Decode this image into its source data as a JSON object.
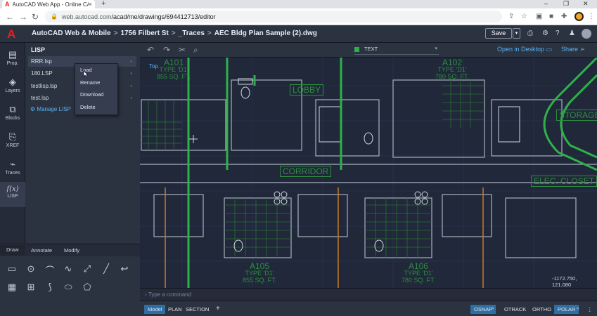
{
  "browser": {
    "tab_title": "AutoCAD Web App - Online CAD",
    "tab_close": "×",
    "new_tab": "+",
    "url_host": "web.autocad.com",
    "url_path": "/acad/me/drawings/694412713/editor",
    "win_min": "–",
    "win_max": "❐",
    "win_close": "✕"
  },
  "header": {
    "breadcrumbs": [
      "AutoCAD Web & Mobile",
      "1756 Filbert St",
      "_Traces",
      "AEC Bldg Plan Sample (2).dwg"
    ],
    "separator": ">",
    "save_label": "Save",
    "save_dropdown": "▾"
  },
  "rail": {
    "items": [
      {
        "icon": "▤",
        "label": "Prop."
      },
      {
        "icon": "◈",
        "label": "Layers"
      },
      {
        "icon": "⧉",
        "label": "Blocks"
      },
      {
        "icon": "⎘",
        "label": "XREF"
      },
      {
        "icon": "⌁",
        "label": "Traces"
      },
      {
        "icon": "f(x)",
        "label": "LISP"
      }
    ]
  },
  "panel": {
    "title": "LISP",
    "files": [
      "RRR.lsp",
      "180.LSP",
      "testlisp.lsp",
      "test.lsp"
    ],
    "manage_label": "Manage LISP",
    "menu": [
      "Load",
      "Rename",
      "Download",
      "Delete"
    ]
  },
  "tools": {
    "tabs": [
      "Draw",
      "Annotate",
      "Modify"
    ]
  },
  "canvas": {
    "layer_name": "TEXT",
    "layer_color": "#2fb14a",
    "open_desktop": "Open in Desktop",
    "share": "Share",
    "view_label": "Top",
    "coords": "-1172.750, 121.080",
    "command_placeholder": "Type a command",
    "rooms": [
      {
        "t": "A101",
        "s": "TYPE 'D1'",
        "a": "855 SQ. FT."
      },
      {
        "t": "A102",
        "s": "TYPE 'D1'",
        "a": "780 SQ. FT."
      },
      {
        "t": "A105",
        "s": "TYPE 'D1'",
        "a": "855 SQ. FT."
      },
      {
        "t": "A106",
        "s": "TYPE 'D1'",
        "a": "780 SQ. FT."
      }
    ],
    "labels": [
      "LOBBY",
      "CORRIDOR",
      "STORAGE",
      "ELEC. CLOSET"
    ]
  },
  "status": {
    "tabs": [
      "Model",
      "PLAN",
      "SECTION"
    ],
    "add": "+",
    "toggles": [
      "OSNAP",
      "OTRACK",
      "ORTHO",
      "POLAR"
    ]
  }
}
